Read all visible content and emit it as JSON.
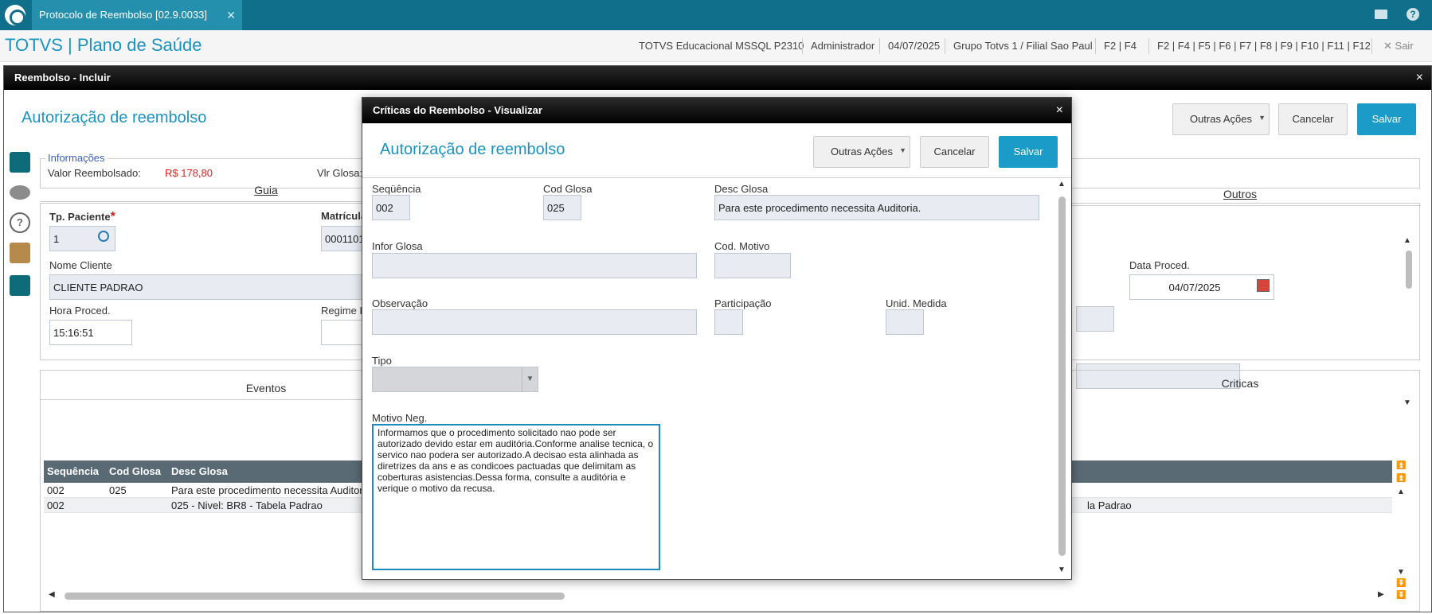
{
  "topbar": {
    "tab_title": "Protocolo de Reembolso [02.9.0033]",
    "tab_close": "✕"
  },
  "header": {
    "brand": "TOTVS | Plano de Saúde",
    "environment": "TOTVS Educacional MSSQL P2310",
    "user": "Administrador",
    "date": "04/07/2025",
    "branch": "Grupo Totvs 1 / Filial Sao Paul",
    "shortcuts_short": "F2 | F4",
    "shortcuts_long": "F2 | F4 | F5 | F6 | F7 | F8 | F9 | F10 | F11 | F12",
    "exit": "Sair"
  },
  "main": {
    "window_title": "Reembolso - Incluir",
    "close": "×",
    "page_title": "Autorização de reembolso",
    "actions": {
      "other": "Outras Ações",
      "cancel": "Cancelar",
      "save": "Salvar"
    },
    "info": {
      "legend": "Informações",
      "reimbursed_label": "Valor Reembolsado:",
      "reimbursed_value": "R$ 178,80",
      "glosa_label": "Vlr Glosa:"
    },
    "tabs": {
      "guia": "Guia",
      "outros": "Outros",
      "eventos": "Eventos",
      "criticas": "Criticas"
    },
    "form": {
      "tp_paciente_label": "Tp. Paciente",
      "tp_paciente_value": "1",
      "matricula_label": "Matrícula",
      "matricula_value": "0001101",
      "nome_cliente_label": "Nome Cliente",
      "nome_cliente_value": "CLIENTE PADRAO",
      "data_proced_label": "Data Proced.",
      "data_proced_value": "04/07/2025",
      "hora_proced_label": "Hora Proced.",
      "hora_proced_value": "15:16:51",
      "regime_label": "Regime I"
    },
    "grid": {
      "headers": [
        "Sequência",
        "Cod Glosa",
        "Desc Glosa"
      ],
      "rows": [
        [
          "002",
          "025",
          "Para este procedimento necessita Auditoria."
        ],
        [
          "002",
          "",
          "025 - Nivel: BR8 - Tabela Padrao"
        ]
      ],
      "right_fragment": "la Padrao"
    }
  },
  "modal": {
    "window_title": "Críticas do Reembolso - Visualizar",
    "close": "×",
    "page_title": "Autorização de reembolso",
    "actions": {
      "other": "Outras Ações",
      "cancel": "Cancelar",
      "save": "Salvar"
    },
    "fields": {
      "sequencia_label": "Seqüência",
      "sequencia_value": "002",
      "cod_glosa_label": "Cod Glosa",
      "cod_glosa_value": "025",
      "desc_glosa_label": "Desc Glosa",
      "desc_glosa_value": "Para este procedimento necessita Auditoria.",
      "infor_glosa_label": "Infor Glosa",
      "cod_motivo_label": "Cod. Motivo",
      "observacao_label": "Observação",
      "participacao_label": "Participação",
      "unid_medida_label": "Unid. Medida",
      "tipo_label": "Tipo",
      "motivo_neg_label": "Motivo Neg.",
      "motivo_neg_value": "Informamos que o procedimento solicitado nao pode ser autorizado devido estar em auditória.Conforme analise tecnica, o servico nao podera ser autorizado.A decisao esta alinhada as diretrizes da ans e as condicoes pactuadas que delimitam as coberturas asistencias.Dessa forma, consulte a auditória e verique o motivo da recusa."
    }
  }
}
